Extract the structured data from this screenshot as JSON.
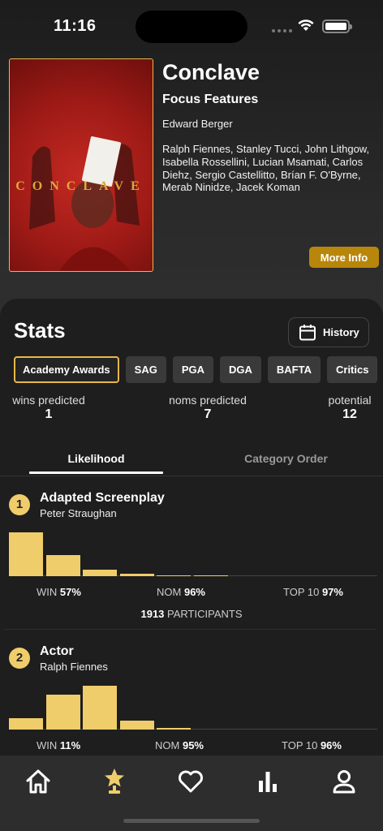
{
  "status_bar": {
    "time": "11:16"
  },
  "movie": {
    "title": "Conclave",
    "studio": "Focus Features",
    "director": "Edward Berger",
    "cast": "Ralph Fiennes, Stanley Tucci, John Lithgow, Isabella Rossellini, Lucian Msamati, Carlos Diehz, Sergio Castellitto, Brían F. O'Byrne, Merab Ninidze, Jacek Koman",
    "poster_word": "CONCLAVE",
    "more_info_label": "More Info"
  },
  "stats": {
    "title": "Stats",
    "history_label": "History",
    "award_tabs": [
      "Academy Awards",
      "SAG",
      "PGA",
      "DGA",
      "BAFTA",
      "Critics"
    ],
    "active_award": "Academy Awards",
    "metrics": [
      {
        "label": "wins predicted",
        "value": "1"
      },
      {
        "label": "noms predicted",
        "value": "7"
      },
      {
        "label": "potential",
        "value": "12"
      }
    ],
    "view_tabs": [
      "Likelihood",
      "Category Order"
    ],
    "active_view": "Likelihood"
  },
  "categories": [
    {
      "rank": "1",
      "name": "Adapted Screenplay",
      "nominee": "Peter Straughan",
      "distribution": [
        1.0,
        0.48,
        0.14,
        0.05,
        0.02,
        0.01
      ],
      "win_label": "WIN",
      "win_value": "57%",
      "nom_label": "NOM",
      "nom_value": "96%",
      "top_label": "TOP 10",
      "top_value": "97%",
      "participants_count": "1913",
      "participants_label": "PARTICIPANTS"
    },
    {
      "rank": "2",
      "name": "Actor",
      "nominee": "Ralph Fiennes",
      "distribution": [
        0.26,
        0.79,
        1.0,
        0.2,
        0.03,
        0.0
      ],
      "win_label": "WIN",
      "win_value": "11%",
      "nom_label": "NOM",
      "nom_value": "95%",
      "top_label": "TOP 10",
      "top_value": "96%"
    }
  ],
  "tabbar": {
    "items": [
      {
        "icon": "home-icon",
        "active": false
      },
      {
        "icon": "trophy-star-icon",
        "active": true
      },
      {
        "icon": "heart-icon",
        "active": false
      },
      {
        "icon": "bar-chart-icon",
        "active": false
      },
      {
        "icon": "person-icon",
        "active": false
      }
    ]
  },
  "colors": {
    "accent": "#f0cd6b",
    "gold_border": "#e6b84a",
    "button_gold": "#b8860b",
    "background": "#1e1e1e"
  }
}
